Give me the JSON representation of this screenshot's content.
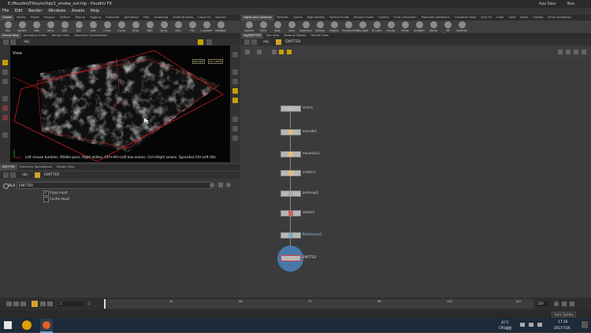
{
  "window": {
    "title": "E:/Houdini/FX/sync/hip/1_smoke_out.hip - Houdini FX",
    "right_label": "Auto Takes",
    "desk": "Main"
  },
  "menu": [
    "File",
    "Edit",
    "Render",
    "Windows",
    "Assets",
    "Help"
  ],
  "shelf_tabs_left": [
    "Create",
    "Modify",
    "Model",
    "Polygon",
    "Deform",
    "Texture",
    "Rigging",
    "Character",
    "Animation",
    "Hair",
    "Grooming",
    "Guide Brushes",
    "Cloud FX",
    "Volume"
  ],
  "shelf_tabs_right": [
    "Lights and Cameras",
    "Particles",
    "Grains",
    "Rigid Bodies",
    "Particle Fluids",
    "Viscous Fluids",
    "Oceans",
    "Fluid Containers",
    "Populate Containers",
    "Container Tools",
    "Pyro FX",
    "Cloth",
    "Solid",
    "Wires",
    "Crowds",
    "Drive Simulation"
  ],
  "shelf_tools_left": [
    "Box",
    "Sphere",
    "Tube",
    "Torus",
    "Grid",
    "Null",
    "Line",
    "Circle",
    "Curve",
    "Draw Curve",
    "Path",
    "Spray Paint",
    "Font",
    "File",
    "L-System",
    "Metaball"
  ],
  "shelf_tools_right": [
    "Camera",
    "Point Light",
    "Spot Light",
    "Area Light",
    "Geometry Light",
    "Volume Light",
    "Distant Light",
    "Environment Light",
    "Sky Light",
    "GI Light",
    "Caustic Light",
    "Portal Light",
    "Ambient Light",
    "Stereo Camera",
    "VR Camera",
    "Switcher"
  ],
  "left_pane_tabs": [
    "Scene View",
    "Animation Editor",
    "Render View",
    "Geometry Spreadsheet"
  ],
  "right_pane_tabs": [
    "obj/EMITTER",
    "Tree View",
    "Material Palette",
    "Render View"
  ],
  "viewport": {
    "label": "View",
    "path": "obj",
    "persp": "persp▾",
    "cam": "no cam▾",
    "hint": "Left mouse tumbles. Middle pans. Right dollies. Ctrl+Alt+Left box-zooms. Ctrl+Right zooms. Spacebar-Ctrl-Left tilts."
  },
  "network": {
    "path_obj": "obj",
    "path_node": "EMITTER",
    "nodes": [
      {
        "label": "circle1"
      },
      {
        "label": "extrude1"
      },
      {
        "label": "mountain1"
      },
      {
        "label": "scatter1"
      },
      {
        "label": "pointvop1"
      },
      {
        "label": "delete1"
      },
      {
        "label": "fluidsource1"
      },
      {
        "label": "EMITTER"
      }
    ]
  },
  "param": {
    "tabs": [
      "EMITTER",
      "Geometry Spreadsheet",
      "Render View"
    ],
    "path_obj": "obj",
    "path_node": "EMITTER",
    "node_type": "Null",
    "node_name": "EMITTER",
    "copy_input": "Copy Input",
    "cache_input": "Cache Input"
  },
  "timeline": {
    "frame": "1",
    "start": "1",
    "end": "150",
    "ticks": [
      "1",
      "24",
      "48",
      "72",
      "96",
      "120",
      "144"
    ],
    "auto_update": "Auto Update"
  },
  "taskbar": {
    "temp": "41°C",
    "cpu": "CPU温度",
    "time": "17:16",
    "date": "2017/7/26"
  }
}
